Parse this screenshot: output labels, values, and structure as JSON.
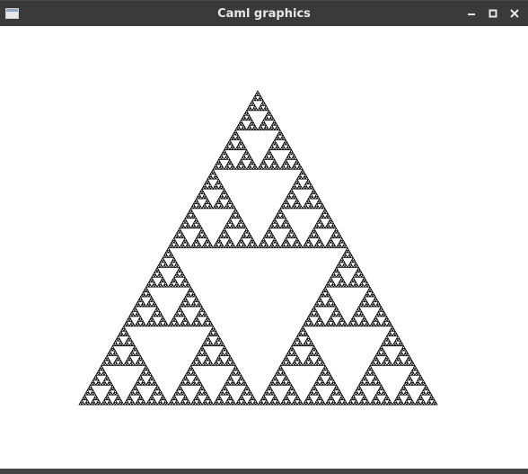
{
  "window": {
    "title": "Caml graphics",
    "icons": {
      "app": "window-app-icon",
      "minimize": "minimize-icon",
      "maximize": "maximize-icon",
      "close": "close-icon"
    }
  },
  "drawing": {
    "shape": "sierpinski-triangle",
    "stroke_color": "#000000",
    "background_color": "#ffffff",
    "recursion_depth": 7
  }
}
